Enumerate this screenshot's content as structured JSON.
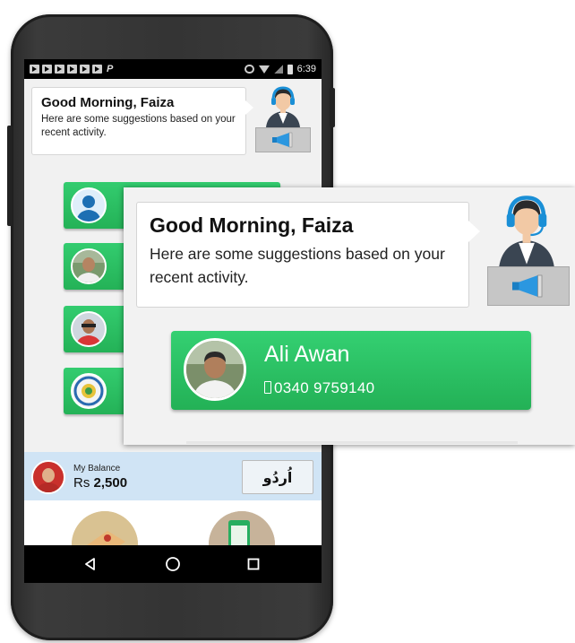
{
  "status_bar": {
    "time": "6:39"
  },
  "greeting": {
    "title": "Good Morning, Faiza",
    "message": "Here are some suggestions based on your recent activity."
  },
  "contacts": [
    {
      "name": "Ali Awan",
      "phone": "0340 9759140"
    }
  ],
  "balance": {
    "label": "My Balance",
    "currency": "Rs",
    "amount": "2,500"
  },
  "language_button": "اُردُو",
  "icons": {
    "agent": "customer-support-agent-icon",
    "megaphone": "megaphone-icon",
    "back": "back-triangle-icon",
    "home": "home-circle-icon",
    "recents": "recents-square-icon"
  },
  "colors": {
    "contact_green": "#2bc263",
    "balance_bar": "#d0e4f5",
    "agent_headset": "#1a8fd6"
  }
}
